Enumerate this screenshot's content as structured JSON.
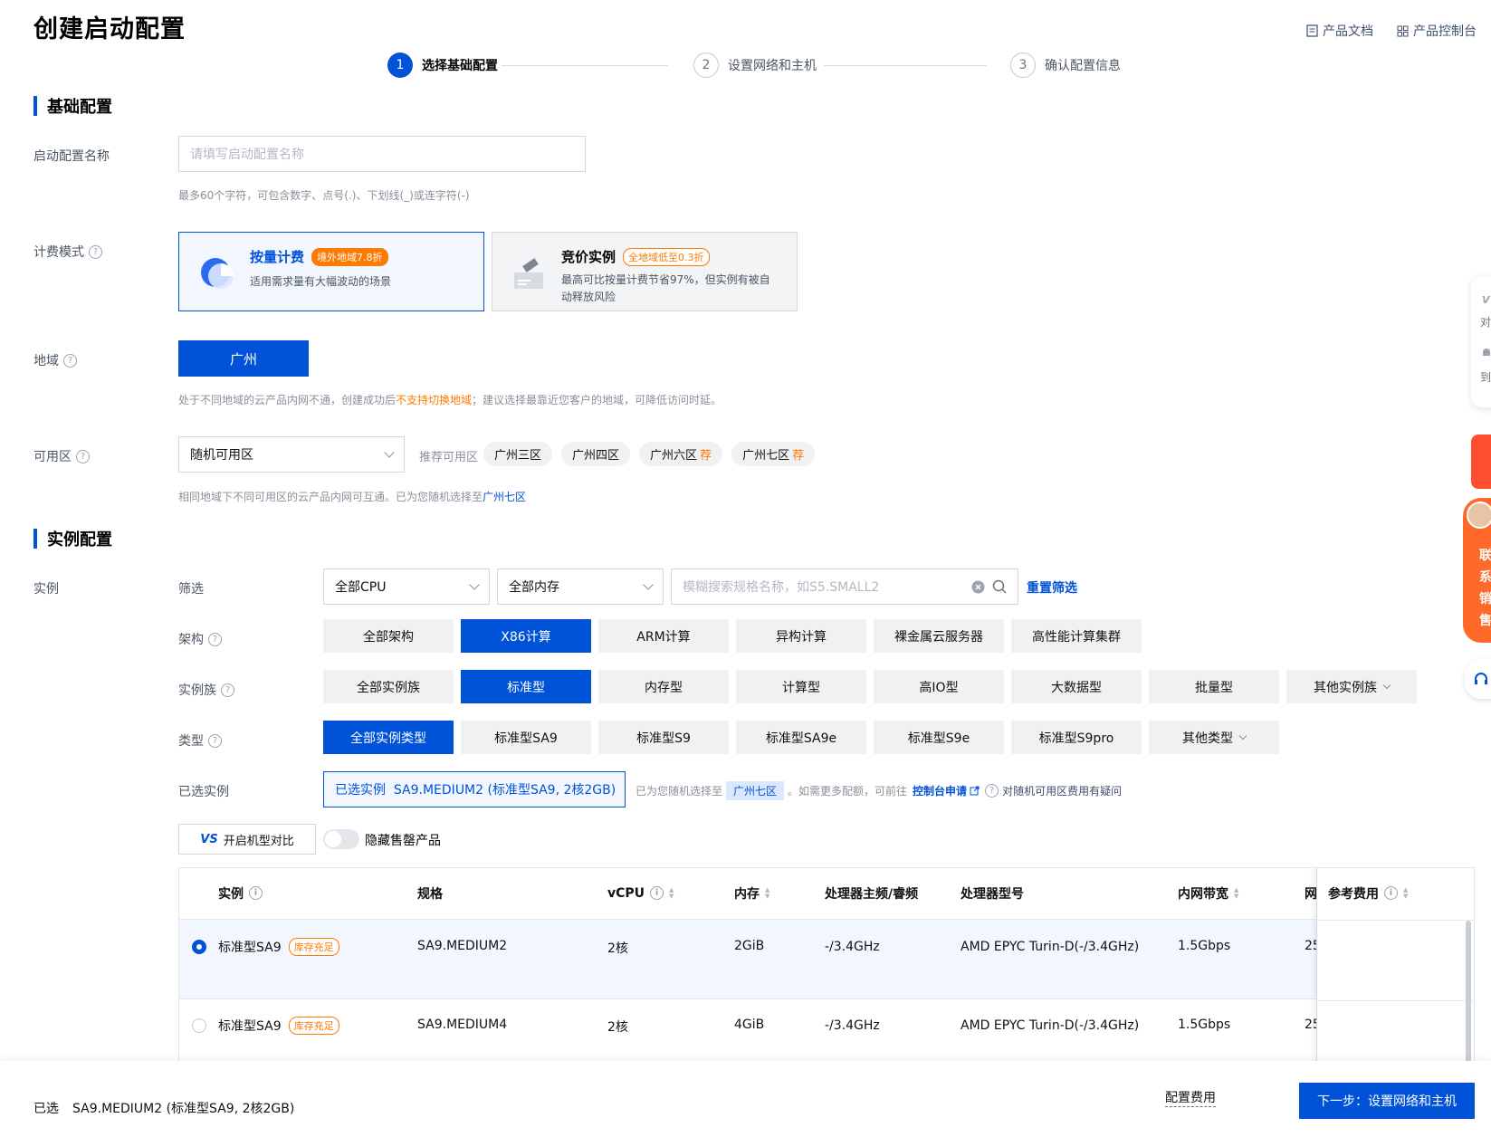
{
  "page_title": "创建启动配置",
  "top_links": {
    "docs": "产品文档",
    "console": "产品控制台"
  },
  "steps": [
    {
      "num": "1",
      "label": "选择基础配置"
    },
    {
      "num": "2",
      "label": "设置网络和主机"
    },
    {
      "num": "3",
      "label": "确认配置信息"
    }
  ],
  "basic": {
    "section_title": "基础配置",
    "name_label": "启动配置名称",
    "name_placeholder": "请填写启动配置名称",
    "name_hint": "最多60个字符，可包含数字、点号(.)、下划线(_)或连字符(-)",
    "billing_label": "计费模式",
    "billing_options": [
      {
        "title": "按量计费",
        "badge": "境外地域7.8折",
        "desc": "适用需求量有大幅波动的场景"
      },
      {
        "title": "竞价实例",
        "badge": "全地域低至0.3折",
        "desc1": "最高可比按量计费节省97%，但实例有被自",
        "desc2": "动释放风险"
      }
    ],
    "region_label": "地域",
    "region_value": "广州",
    "region_hint_a": "处于不同地域的云产品内网不通，创建成功后",
    "region_hint_warn": "不支持切换地域",
    "region_hint_b": "；建议选择最靠近您客户的地域，可降低访问时延。",
    "zone_label": "可用区",
    "zone_value": "随机可用区",
    "zone_rec_label": "推荐可用区",
    "zones": [
      "广州三区",
      "广州四区",
      "广州六区",
      "广州七区"
    ],
    "zone_rec_mark": "荐",
    "zone_hint_a": "相同地域下不同可用区的云产品内网可互通。已为您随机选择至",
    "zone_hint_link": "广州七区"
  },
  "instance": {
    "section_title": "实例配置",
    "label": "实例",
    "filter_label": "筛选",
    "cpu_select": "全部CPU",
    "mem_select": "全部内存",
    "search_placeholder": "模糊搜索规格名称，如S5.SMALL2",
    "reset": "重置筛选",
    "arch_label": "架构",
    "arch": [
      "全部架构",
      "X86计算",
      "ARM计算",
      "异构计算",
      "裸金属云服务器",
      "高性能计算集群"
    ],
    "family_label": "实例族",
    "family": [
      "全部实例族",
      "标准型",
      "内存型",
      "计算型",
      "高IO型",
      "大数据型",
      "批量型",
      "其他实例族"
    ],
    "type_label": "类型",
    "types": [
      "全部实例类型",
      "标准型SA9",
      "标准型S9",
      "标准型SA9e",
      "标准型S9e",
      "标准型S9pro",
      "其他类型"
    ],
    "selected_label": "已选实例",
    "selected_value": "已选实例  SA9.MEDIUM2 (标准型SA9, 2核2GB)",
    "selected_note_a": "已为您随机选择至",
    "selected_zone": "广州七区",
    "selected_note_b": "。如需更多配额，可前往",
    "selected_link": "控制台申请",
    "selected_note_c": "对随机可用区费用有疑问",
    "compare_btn": "开启机型对比",
    "hide_soldout": "隐藏售罄产品"
  },
  "table": {
    "headers": [
      "实例",
      "规格",
      "vCPU",
      "内存",
      "处理器主频/睿频",
      "处理器型号",
      "内网带宽",
      "网",
      "参考费用"
    ],
    "rows": [
      {
        "name": "标准型SA9",
        "badge": "库存充足",
        "spec": "SA9.MEDIUM2",
        "vcpu": "2核",
        "mem": "2GiB",
        "freq": "-/3.4GHz",
        "cpu": "AMD EPYC Turin-D(-/3.4GHz)",
        "bw": "1.5Gbps",
        "extra": "25"
      },
      {
        "name": "标准型SA9",
        "badge": "库存充足",
        "spec": "SA9.MEDIUM4",
        "vcpu": "2核",
        "mem": "4GiB",
        "freq": "-/3.4GHz",
        "cpu": "AMD EPYC Turin-D(-/3.4GHz)",
        "bw": "1.5Gbps",
        "extra": "25"
      }
    ]
  },
  "footer": {
    "selected_label": "已选",
    "selected_value": "SA9.MEDIUM2 (标准型SA9, 2核2GB)",
    "fee_label": "配置费用",
    "next_button": "下一步：设置网络和主机"
  },
  "side": {
    "t1": "对",
    "t2": "到",
    "t3": "联",
    "t4": "系",
    "t5": "销",
    "t6": "售"
  },
  "colors": {
    "primary": "#0052d9",
    "warning": "#ff7a00"
  }
}
